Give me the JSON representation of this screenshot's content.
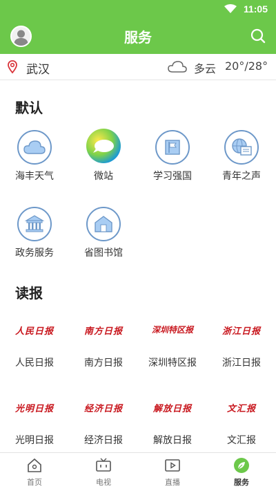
{
  "status_bar": {
    "time": "11:05"
  },
  "header": {
    "title": "服务"
  },
  "info_bar": {
    "city": "武汉",
    "weather": "多云",
    "temperature": "20°/28°"
  },
  "sections": {
    "default": {
      "title": "默认",
      "items": [
        {
          "label": "海丰天气",
          "icon": "cloud-icon"
        },
        {
          "label": "微站",
          "icon": "weizhan-icon"
        },
        {
          "label": "学习强国",
          "icon": "flag-icon"
        },
        {
          "label": "青年之声",
          "icon": "globe-news-icon"
        },
        {
          "label": "政务服务",
          "icon": "government-building-icon"
        },
        {
          "label": "省图书馆",
          "icon": "library-icon"
        }
      ]
    },
    "newspapers": {
      "title": "读报",
      "items": [
        {
          "label": "人民日报",
          "logo": "人民日报"
        },
        {
          "label": "南方日报",
          "logo": "南方日报"
        },
        {
          "label": "深圳特区报",
          "logo": "深圳特区报"
        },
        {
          "label": "浙江日报",
          "logo": "浙江日报"
        },
        {
          "label": "光明日报",
          "logo": "光明日报"
        },
        {
          "label": "经济日报",
          "logo": "经济日报"
        },
        {
          "label": "解放日报",
          "logo": "解放日报"
        },
        {
          "label": "文汇报",
          "logo": "文汇报"
        }
      ]
    }
  },
  "bottom_nav": [
    {
      "label": "首页",
      "icon": "home-icon"
    },
    {
      "label": "电视",
      "icon": "tv-icon"
    },
    {
      "label": "直播",
      "icon": "live-video-icon"
    },
    {
      "label": "服务",
      "icon": "service-leaf-icon",
      "active": true
    }
  ],
  "colors": {
    "brand_green": "#6cc84a",
    "icon_blue": "#6d98c9",
    "newspaper_red": "#c8161d"
  }
}
